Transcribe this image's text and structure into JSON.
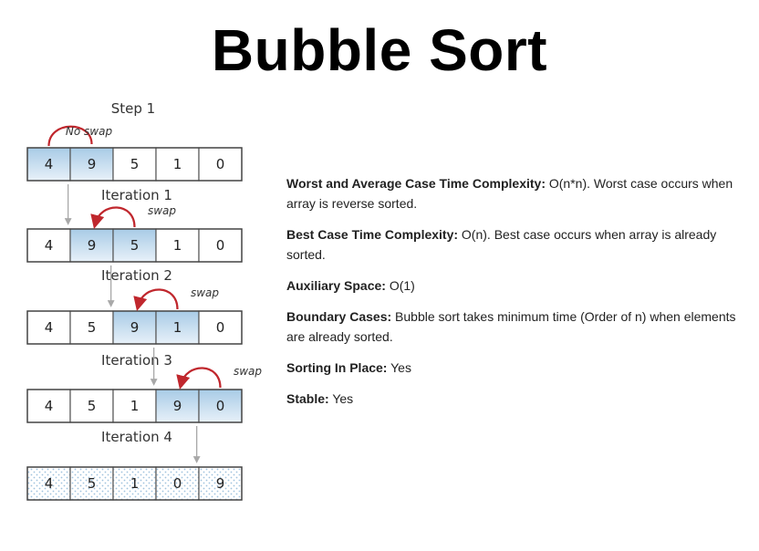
{
  "title": "Bubble Sort",
  "diagram": {
    "step_label": "Step 1",
    "no_swap_label": "No swap",
    "swap_label": "swap",
    "iterations": [
      "Iteration 1",
      "Iteration 2",
      "Iteration 3",
      "Iteration 4"
    ],
    "rows": [
      {
        "values": [
          "4",
          "9",
          "5",
          "1",
          "0"
        ],
        "highlight": [
          0,
          1
        ],
        "arrow": [
          0,
          1
        ],
        "arrow_label": "No swap",
        "dotted": false
      },
      {
        "values": [
          "4",
          "9",
          "5",
          "1",
          "0"
        ],
        "highlight": [
          1,
          2
        ],
        "arrow": [
          1,
          2
        ],
        "arrow_label": "swap",
        "dotted": false
      },
      {
        "values": [
          "4",
          "5",
          "9",
          "1",
          "0"
        ],
        "highlight": [
          2,
          3
        ],
        "arrow": [
          2,
          3
        ],
        "arrow_label": "swap",
        "dotted": false
      },
      {
        "values": [
          "4",
          "5",
          "1",
          "9",
          "0"
        ],
        "highlight": [
          3,
          4
        ],
        "arrow": [
          3,
          4
        ],
        "arrow_label": "swap",
        "dotted": false
      },
      {
        "values": [
          "4",
          "5",
          "1",
          "0",
          "9"
        ],
        "highlight": [],
        "arrow": null,
        "arrow_label": "",
        "dotted": true
      }
    ],
    "colors": {
      "highlight": "#a8cbe6",
      "arrow": "#c0272d",
      "border": "#555555"
    }
  },
  "info": [
    {
      "label": "Worst and Average Case Time Complexity:",
      "text": " O(n*n). Worst case occurs when array is reverse sorted."
    },
    {
      "label": "Best Case Time Complexity:",
      "text": " O(n). Best case occurs when array is already sorted."
    },
    {
      "label": "Auxiliary Space:",
      "text": " O(1)"
    },
    {
      "label": "Boundary Cases:",
      "text": " Bubble sort takes minimum time (Order of n) when elements are already sorted."
    },
    {
      "label": "Sorting In Place:",
      "text": " Yes"
    },
    {
      "label": "Stable:",
      "text": " Yes"
    }
  ]
}
